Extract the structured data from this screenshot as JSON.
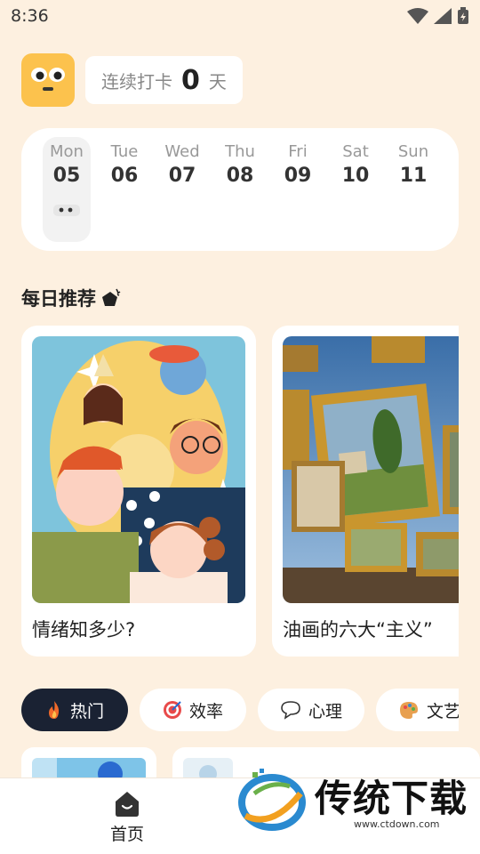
{
  "status_bar": {
    "time": "8:36"
  },
  "header": {
    "streak_label": "连续打卡",
    "streak_count": "0",
    "streak_unit": "天"
  },
  "week": [
    {
      "name": "Mon",
      "num": "05",
      "selected": true
    },
    {
      "name": "Tue",
      "num": "06"
    },
    {
      "name": "Wed",
      "num": "07"
    },
    {
      "name": "Thu",
      "num": "08"
    },
    {
      "name": "Fri",
      "num": "09"
    },
    {
      "name": "Sat",
      "num": "10"
    },
    {
      "name": "Sun",
      "num": "11"
    }
  ],
  "daily": {
    "title": "每日推荐",
    "cards": [
      {
        "title": "情绪知多少?"
      },
      {
        "title": "油画的六大“主义”"
      }
    ]
  },
  "chips": [
    {
      "label": "热门",
      "icon": "fire-icon",
      "active": true
    },
    {
      "label": "效率",
      "icon": "target-icon"
    },
    {
      "label": "心理",
      "icon": "speech-bubble-icon"
    },
    {
      "label": "文艺",
      "icon": "palette-icon"
    }
  ],
  "tab_bar": {
    "home_label": "首页"
  },
  "watermark": {
    "text": "传统下载",
    "sub": "www.ctdown.com"
  },
  "colors": {
    "background": "#fdf0e0",
    "accent_yellow": "#fcc24d",
    "active_chip": "#1a2233"
  }
}
